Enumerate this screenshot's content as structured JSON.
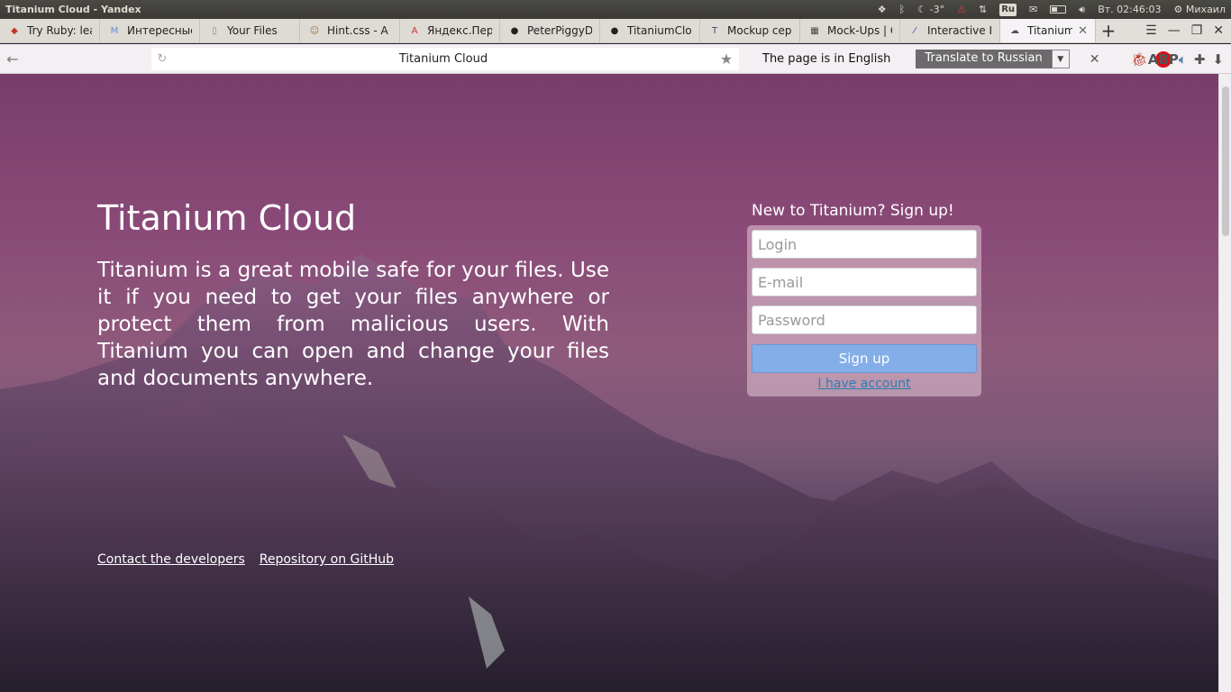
{
  "os_panel": {
    "window_title": "Titanium Cloud - Yandex",
    "weather": "-3°",
    "keyboard_layout": "Ru",
    "clock": "Вт. 02:46:03",
    "user": "Михаил"
  },
  "tabs": [
    {
      "label": "Try Ruby: lear",
      "icon": "ruby-icon",
      "color": "#c0392b"
    },
    {
      "label": "Интересные",
      "icon": "m-icon",
      "color": "#6a8ccc"
    },
    {
      "label": "Your Files",
      "icon": "page-icon",
      "color": "#888888"
    },
    {
      "label": "Hint.css - A to",
      "icon": "avatar-icon",
      "color": "#a0703a"
    },
    {
      "label": "Яндекс.Перев",
      "icon": "yandex-icon",
      "color": "#d32f2f"
    },
    {
      "label": "PeterPiggyDe",
      "icon": "github-icon",
      "color": "#222222"
    },
    {
      "label": "TitaniumClou",
      "icon": "github-icon",
      "color": "#222222"
    },
    {
      "label": "Mockup серв",
      "icon": "t-icon",
      "color": "#3a4a6a"
    },
    {
      "label": "Mock-Ups | Gr",
      "icon": "grid-icon",
      "color": "#444444"
    },
    {
      "label": "Interactive Im",
      "icon": "feather-icon",
      "color": "#2244aa"
    },
    {
      "label": "Titanium C",
      "icon": "cloud-icon",
      "color": "#555555",
      "active": true
    }
  ],
  "toolbar": {
    "url_text": "Titanium Cloud",
    "translate_message": "The page is in English",
    "translate_button": "Translate to Russian",
    "abp_label": "ABP"
  },
  "page": {
    "title": "Titanium Cloud",
    "description": "Titanium is a great mobile safe for your files. Use it if you need to get your files anywhere or protect them from malicious users. With Titanium you can open and change your files and documents anywhere.",
    "signup_heading": "New to Titanium? Sign up!",
    "form": {
      "login_placeholder": "Login",
      "email_placeholder": "E-mail",
      "password_placeholder": "Password",
      "signup_label": "Sign up",
      "have_account_label": "I have account"
    },
    "footer": {
      "contact_label": "Contact the developers",
      "repo_label": "Repository on GitHub"
    }
  }
}
